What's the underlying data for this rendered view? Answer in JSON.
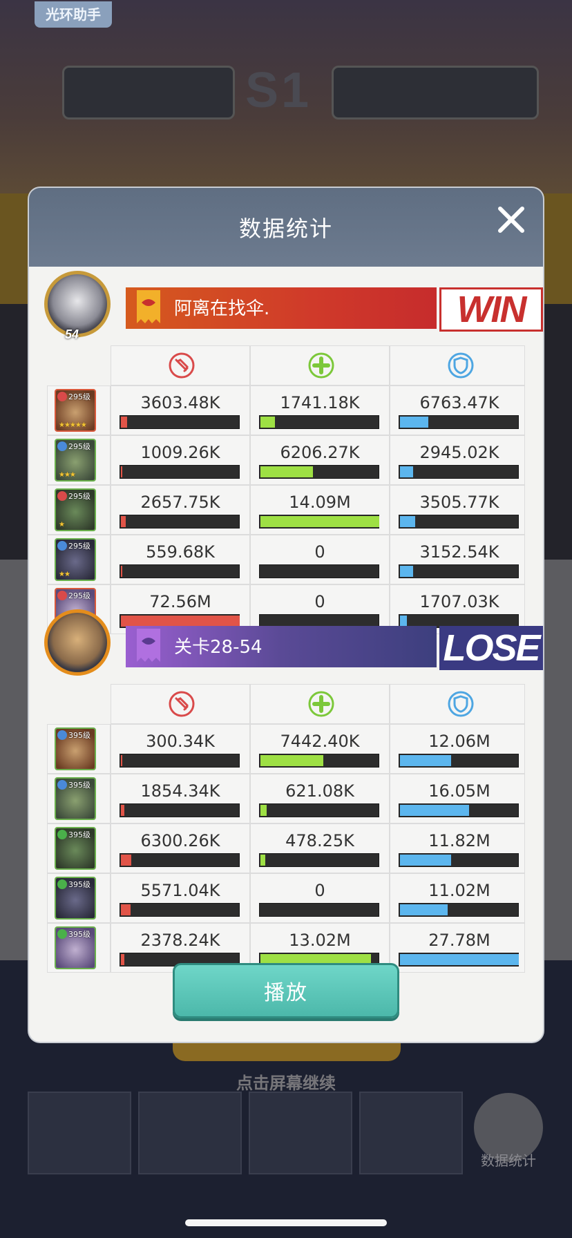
{
  "top_tag": "光环助手",
  "title": "数据统计",
  "play_button": "播放",
  "colors": {
    "damage": "#e15448",
    "heal": "#9ee044",
    "tank": "#5cb6ee",
    "play_button": "#5cc6b8",
    "win": "#c8302e",
    "lose": "#3a3a82"
  },
  "icons": {
    "close": "close-icon",
    "damage": "sword-icon",
    "heal": "plus-icon",
    "tank": "shield-icon"
  },
  "teams": [
    {
      "name": "阿离在找伞.",
      "avatar_level": "54",
      "result": "WIN",
      "result_type": "win",
      "heroes": [
        {
          "level": "295级",
          "stars": "★★★★★",
          "damage": "3603.48K",
          "damage_pct": 5,
          "heal": "1741.18K",
          "heal_pct": 12,
          "tank": "6763.47K",
          "tank_pct": 24
        },
        {
          "level": "295级",
          "stars": "★★★",
          "damage": "1009.26K",
          "damage_pct": 1,
          "heal": "6206.27K",
          "heal_pct": 44,
          "tank": "2945.02K",
          "tank_pct": 11
        },
        {
          "level": "295级",
          "stars": "★",
          "damage": "2657.75K",
          "damage_pct": 4,
          "heal": "14.09M",
          "heal_pct": 100,
          "tank": "3505.77K",
          "tank_pct": 13
        },
        {
          "level": "295级",
          "stars": "★★",
          "damage": "559.68K",
          "damage_pct": 1,
          "heal": "0",
          "heal_pct": 0,
          "tank": "3152.54K",
          "tank_pct": 11
        },
        {
          "level": "295级",
          "stars": "★★★★★",
          "damage": "72.56M",
          "damage_pct": 100,
          "heal": "0",
          "heal_pct": 0,
          "tank": "1707.03K",
          "tank_pct": 6
        }
      ]
    },
    {
      "name": "关卡28-54",
      "avatar_level": "",
      "result": "LOSE",
      "result_type": "lose",
      "heroes": [
        {
          "level": "395级",
          "stars": "",
          "damage": "300.34K",
          "damage_pct": 1,
          "heal": "7442.40K",
          "heal_pct": 53,
          "tank": "12.06M",
          "tank_pct": 43
        },
        {
          "level": "395级",
          "stars": "",
          "damage": "1854.34K",
          "damage_pct": 3,
          "heal": "621.08K",
          "heal_pct": 5,
          "tank": "16.05M",
          "tank_pct": 58
        },
        {
          "level": "395级",
          "stars": "",
          "damage": "6300.26K",
          "damage_pct": 9,
          "heal": "478.25K",
          "heal_pct": 4,
          "tank": "11.82M",
          "tank_pct": 43
        },
        {
          "level": "395级",
          "stars": "",
          "damage": "5571.04K",
          "damage_pct": 8,
          "heal": "0",
          "heal_pct": 0,
          "tank": "11.02M",
          "tank_pct": 40
        },
        {
          "level": "395级",
          "stars": "",
          "damage": "2378.24K",
          "damage_pct": 3,
          "heal": "13.02M",
          "heal_pct": 93,
          "tank": "27.78M",
          "tank_pct": 100
        }
      ]
    }
  ]
}
